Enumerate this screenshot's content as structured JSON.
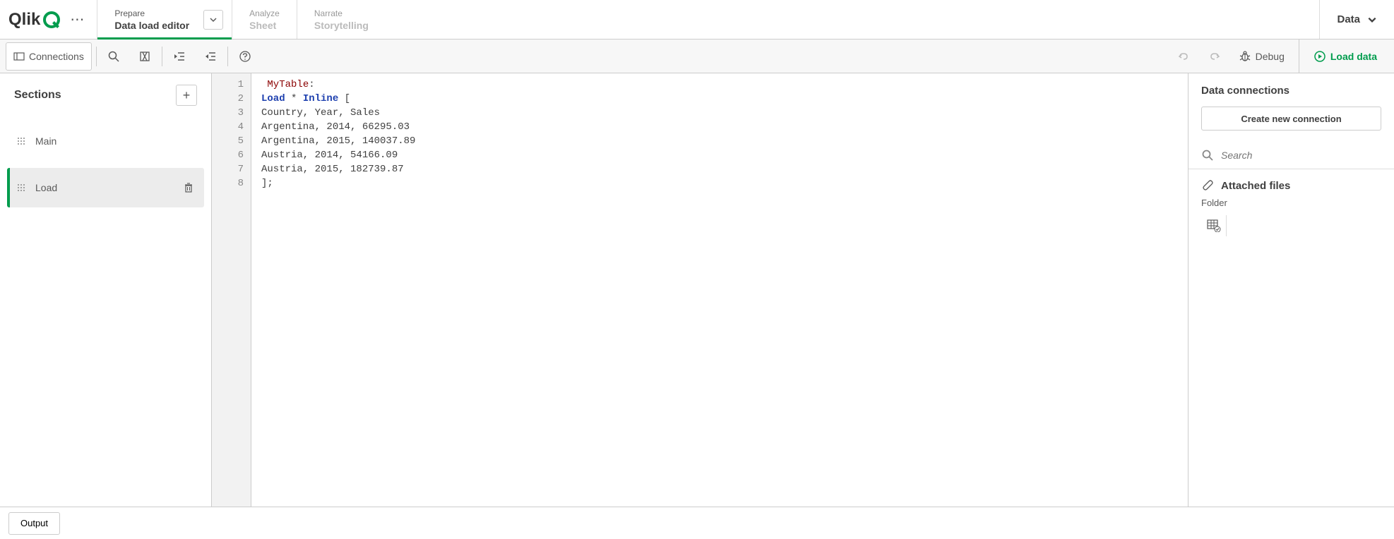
{
  "logo_text": "Qlik",
  "nav": {
    "tabs": [
      {
        "label": "Prepare",
        "sub": "Data load editor",
        "active": true,
        "dropdown": true
      },
      {
        "label": "Analyze",
        "sub": "Sheet",
        "active": false,
        "dropdown": false
      },
      {
        "label": "Narrate",
        "sub": "Storytelling",
        "active": false,
        "dropdown": false
      }
    ],
    "app_dropdown": "Data"
  },
  "toolbar": {
    "connections": "Connections",
    "debug": "Debug",
    "load_data": "Load data"
  },
  "sections": {
    "title": "Sections",
    "items": [
      {
        "name": "Main",
        "active": false
      },
      {
        "name": "Load",
        "active": true
      }
    ]
  },
  "editor": {
    "lines": [
      {
        "n": 1,
        "type": "table",
        "table": "MyTable",
        "suffix": ":"
      },
      {
        "n": 2,
        "type": "loadinline",
        "load": "Load",
        "star": " * ",
        "inline": "Inline",
        "suffix": " ["
      },
      {
        "n": 3,
        "type": "plain",
        "text": "Country, Year, Sales"
      },
      {
        "n": 4,
        "type": "plain",
        "text": "Argentina, 2014, 66295.03"
      },
      {
        "n": 5,
        "type": "plain",
        "text": "Argentina, 2015, 140037.89"
      },
      {
        "n": 6,
        "type": "plain",
        "text": "Austria, 2014, 54166.09"
      },
      {
        "n": 7,
        "type": "plain",
        "text": "Austria, 2015, 182739.87"
      },
      {
        "n": 8,
        "type": "plain",
        "text": "];"
      }
    ]
  },
  "right": {
    "title": "Data connections",
    "create_btn": "Create new connection",
    "search_placeholder": "Search",
    "attached_title": "Attached files",
    "folder_label": "Folder"
  },
  "status": {
    "output": "Output"
  }
}
